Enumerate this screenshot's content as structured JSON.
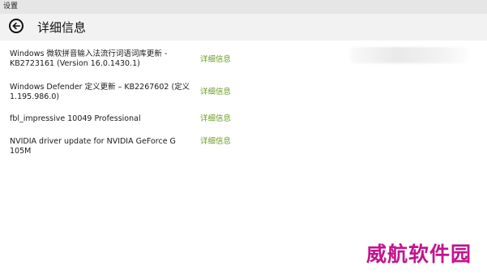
{
  "window": {
    "title": "设置"
  },
  "header": {
    "back_icon": "back-arrow-circle-icon",
    "page_title": "详细信息"
  },
  "updates": [
    {
      "name": "Windows 微软拼音输入法流行词语词库更新 - KB2723161 (Version 16.0.1430.1)",
      "details_label": "详细信息"
    },
    {
      "name": "Windows Defender 定义更新 – KB2267602 (定义 1.195.986.0)",
      "details_label": "详细信息"
    },
    {
      "name": "fbl_impressive 10049 Professional",
      "details_label": "详细信息"
    },
    {
      "name": "NVIDIA driver update for NVIDIA GeForce G 105M",
      "details_label": "详细信息"
    }
  ],
  "watermark": {
    "text": "威航软件园"
  },
  "colors": {
    "link": "#6b9a1f",
    "titlebar": "#e6e6e6",
    "header": "#f2f2f2",
    "watermark": "#c2148f"
  }
}
